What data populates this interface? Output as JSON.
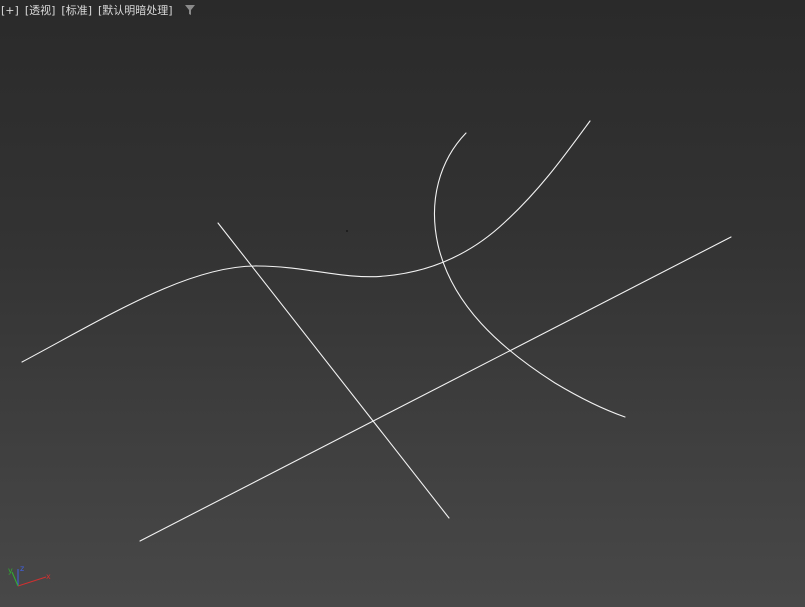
{
  "viewport": {
    "labels": {
      "plus": "[+]",
      "view": "[透视]",
      "shading_style": "[标准]",
      "lighting": "[默认明暗处理]"
    },
    "filter_icon": "filter-icon",
    "background_color_top": "#2a2a2a",
    "background_color_bottom": "#484848",
    "spline_color": "#f2f2f2"
  },
  "axis_gizmo": {
    "x_label": "x",
    "y_label": "y",
    "z_label": "z",
    "x_color": "#d03030",
    "y_color": "#30b030",
    "z_color": "#4060e0"
  }
}
